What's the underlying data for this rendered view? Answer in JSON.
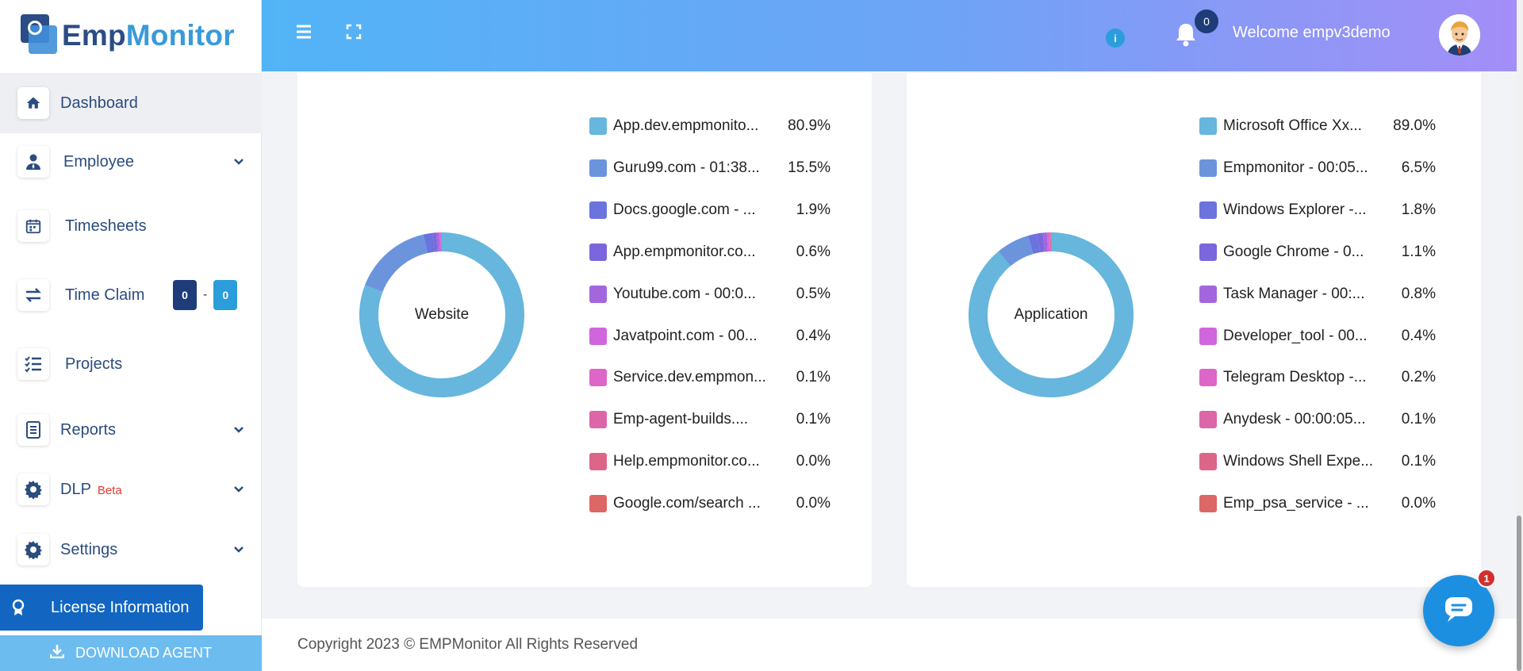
{
  "brand": {
    "part1": "Emp",
    "part2": "Monitor"
  },
  "sidebar": {
    "items": [
      {
        "label": "Dashboard",
        "icon": "home-icon",
        "active": true
      },
      {
        "label": "Employee",
        "icon": "user-tie-icon",
        "chevron": true
      },
      {
        "label": "Timesheets",
        "icon": "calendar-icon"
      },
      {
        "label": "Time Claim",
        "icon": "swap-arrows-icon",
        "badge_left": "0",
        "badge_sep": "-",
        "badge_right": "0"
      },
      {
        "label": "Projects",
        "icon": "task-list-icon"
      },
      {
        "label": "Reports",
        "icon": "report-icon",
        "chevron": true
      },
      {
        "label": "DLP",
        "icon": "gear-icon",
        "tag": "Beta",
        "chevron": true
      },
      {
        "label": "Settings",
        "icon": "gear-icon",
        "chevron": true
      }
    ],
    "license_label": "License Information",
    "download_label": "DOWNLOAD AGENT"
  },
  "header": {
    "info_icon": "info-icon",
    "notification_count": "0",
    "welcome_text": "Welcome  empv3demo"
  },
  "website_chart": {
    "center_label": "Website",
    "items": [
      {
        "name": "App.dev.empmonito...",
        "pct": "80.9%",
        "value": 80.9,
        "color": "#66b6dd"
      },
      {
        "name": "Guru99.com - 01:38...",
        "pct": "15.5%",
        "value": 15.5,
        "color": "#6b94dd"
      },
      {
        "name": "Docs.google.com - ...",
        "pct": "1.9%",
        "value": 1.9,
        "color": "#6b73dd"
      },
      {
        "name": "App.empmonitor.co...",
        "pct": "0.6%",
        "value": 0.6,
        "color": "#7b66dd"
      },
      {
        "name": "Youtube.com - 00:0...",
        "pct": "0.5%",
        "value": 0.5,
        "color": "#a466dd"
      },
      {
        "name": "Javatpoint.com - 00...",
        "pct": "0.4%",
        "value": 0.4,
        "color": "#cf66dd"
      },
      {
        "name": "Service.dev.empmon...",
        "pct": "0.1%",
        "value": 0.1,
        "color": "#dd66c9"
      },
      {
        "name": "Emp-agent-builds....",
        "pct": "0.1%",
        "value": 0.1,
        "color": "#dd66a8"
      },
      {
        "name": "Help.empmonitor.co...",
        "pct": "0.0%",
        "value": 0.0,
        "color": "#dd6688"
      },
      {
        "name": "Google.com/search ...",
        "pct": "0.0%",
        "value": 0.0,
        "color": "#dd6666"
      }
    ]
  },
  "application_chart": {
    "center_label": "Application",
    "items": [
      {
        "name": "Microsoft Office Xx...",
        "pct": "89.0%",
        "value": 89.0,
        "color": "#66b6dd"
      },
      {
        "name": "Empmonitor - 00:05...",
        "pct": "6.5%",
        "value": 6.5,
        "color": "#6b94dd"
      },
      {
        "name": "Windows Explorer -...",
        "pct": "1.8%",
        "value": 1.8,
        "color": "#6b73dd"
      },
      {
        "name": "Google Chrome - 0...",
        "pct": "1.1%",
        "value": 1.1,
        "color": "#7b66dd"
      },
      {
        "name": "Task Manager - 00:...",
        "pct": "0.8%",
        "value": 0.8,
        "color": "#a466dd"
      },
      {
        "name": "Developer_tool - 00...",
        "pct": "0.4%",
        "value": 0.4,
        "color": "#cf66dd"
      },
      {
        "name": "Telegram Desktop -...",
        "pct": "0.2%",
        "value": 0.2,
        "color": "#dd66c9"
      },
      {
        "name": "Anydesk - 00:00:05...",
        "pct": "0.1%",
        "value": 0.1,
        "color": "#dd66a8"
      },
      {
        "name": "Windows Shell Expe...",
        "pct": "0.1%",
        "value": 0.1,
        "color": "#dd6688"
      },
      {
        "name": "Emp_psa_service - ...",
        "pct": "0.0%",
        "value": 0.0,
        "color": "#dd6666"
      }
    ]
  },
  "footer": {
    "copyright": "Copyright 2023 © EMPMonitor All Rights Reserved"
  },
  "chat": {
    "unread": "1"
  }
}
